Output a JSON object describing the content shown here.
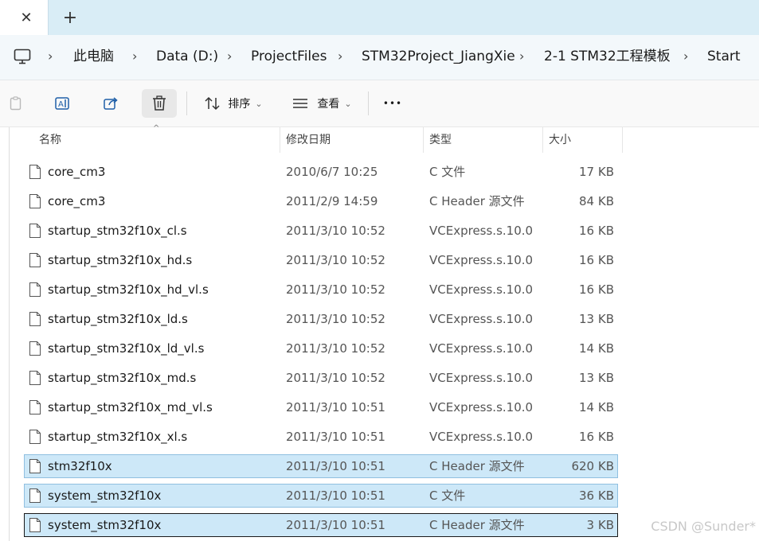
{
  "tabs": {
    "close_glyph": "✕",
    "new_glyph": "+"
  },
  "breadcrumb": {
    "separator": "›",
    "items": [
      "此电脑",
      "Data (D:)",
      "ProjectFiles",
      "STM32Project_JiangXie",
      "2-1 STM32工程模板",
      "Start"
    ]
  },
  "toolbar": {
    "sort_label": "排序",
    "view_label": "查看",
    "more_label": "•••",
    "icons": [
      "paste-icon",
      "rename-icon",
      "share-icon",
      "delete-icon",
      "sort-icon",
      "view-icon",
      "more-icon"
    ]
  },
  "columns": {
    "name": "名称",
    "date": "修改日期",
    "type": "类型",
    "size": "大小"
  },
  "files": [
    {
      "name": "core_cm3",
      "date": "2010/6/7 10:25",
      "type": "C 文件",
      "size": "17 KB",
      "selected": false
    },
    {
      "name": "core_cm3",
      "date": "2011/2/9 14:59",
      "type": "C Header 源文件",
      "size": "84 KB",
      "selected": false
    },
    {
      "name": "startup_stm32f10x_cl.s",
      "date": "2011/3/10 10:52",
      "type": "VCExpress.s.10.0",
      "size": "16 KB",
      "selected": false
    },
    {
      "name": "startup_stm32f10x_hd.s",
      "date": "2011/3/10 10:52",
      "type": "VCExpress.s.10.0",
      "size": "16 KB",
      "selected": false
    },
    {
      "name": "startup_stm32f10x_hd_vl.s",
      "date": "2011/3/10 10:52",
      "type": "VCExpress.s.10.0",
      "size": "16 KB",
      "selected": false
    },
    {
      "name": "startup_stm32f10x_ld.s",
      "date": "2011/3/10 10:52",
      "type": "VCExpress.s.10.0",
      "size": "13 KB",
      "selected": false
    },
    {
      "name": "startup_stm32f10x_ld_vl.s",
      "date": "2011/3/10 10:52",
      "type": "VCExpress.s.10.0",
      "size": "14 KB",
      "selected": false
    },
    {
      "name": "startup_stm32f10x_md.s",
      "date": "2011/3/10 10:52",
      "type": "VCExpress.s.10.0",
      "size": "13 KB",
      "selected": false
    },
    {
      "name": "startup_stm32f10x_md_vl.s",
      "date": "2011/3/10 10:51",
      "type": "VCExpress.s.10.0",
      "size": "14 KB",
      "selected": false
    },
    {
      "name": "startup_stm32f10x_xl.s",
      "date": "2011/3/10 10:51",
      "type": "VCExpress.s.10.0",
      "size": "16 KB",
      "selected": false
    },
    {
      "name": "stm32f10x",
      "date": "2011/3/10 10:51",
      "type": "C Header 源文件",
      "size": "620 KB",
      "selected": true
    },
    {
      "name": "system_stm32f10x",
      "date": "2011/3/10 10:51",
      "type": "C 文件",
      "size": "36 KB",
      "selected": true
    },
    {
      "name": "system_stm32f10x",
      "date": "2011/3/10 10:51",
      "type": "C Header 源文件",
      "size": "3 KB",
      "selected": true,
      "focused": true
    }
  ],
  "watermark": "CSDN @Sunder*",
  "colors": {
    "tabbar": "#d9edf6",
    "selection": "#cde8f8",
    "selection_border": "#8fbfe0"
  }
}
